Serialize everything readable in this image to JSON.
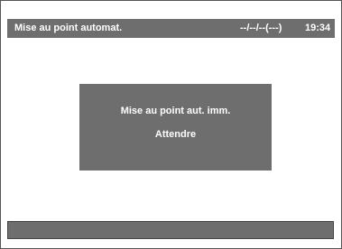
{
  "header": {
    "title": "Mise au point automat.",
    "date": "--/--/--(---)",
    "time": "19:34"
  },
  "dialog": {
    "message": "Mise au point aut. imm.",
    "status": "Attendre"
  },
  "colors": {
    "panel": "#6e6e6e",
    "text": "#ffffff",
    "background": "#ffffff"
  }
}
